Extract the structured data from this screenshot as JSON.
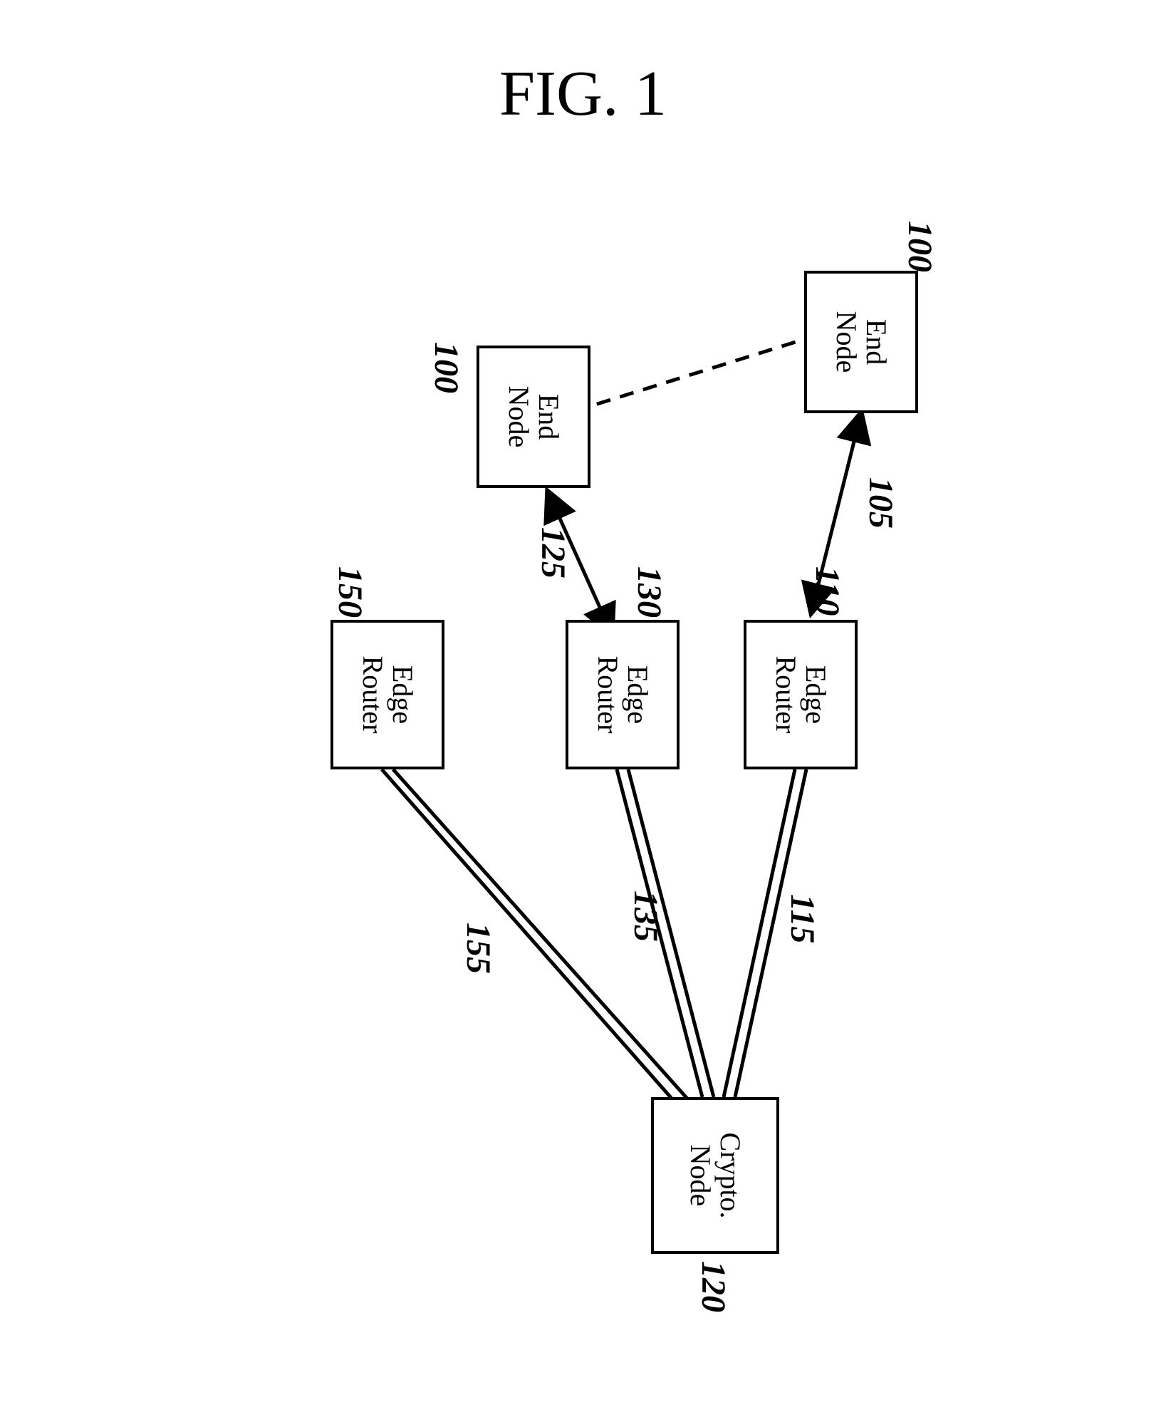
{
  "figure_title": "FIG. 1",
  "nodes": {
    "end_node_1": {
      "line1": "End",
      "line2": "Node",
      "ref": "100"
    },
    "end_node_2": {
      "line1": "End",
      "line2": "Node",
      "ref": "100"
    },
    "edge_router_1": {
      "line1": "Edge",
      "line2": "Router",
      "ref": "110"
    },
    "edge_router_2": {
      "line1": "Edge",
      "line2": "Router",
      "ref": "130"
    },
    "edge_router_3": {
      "line1": "Edge",
      "line2": "Router",
      "ref": "150"
    },
    "crypto_node": {
      "line1": "Crypto.",
      "line2": "Node",
      "ref": "120"
    }
  },
  "links": {
    "en1_er1": "105",
    "en2_er2": "125",
    "er1_cn": "115",
    "er2_cn": "135",
    "er3_cn": "155"
  }
}
